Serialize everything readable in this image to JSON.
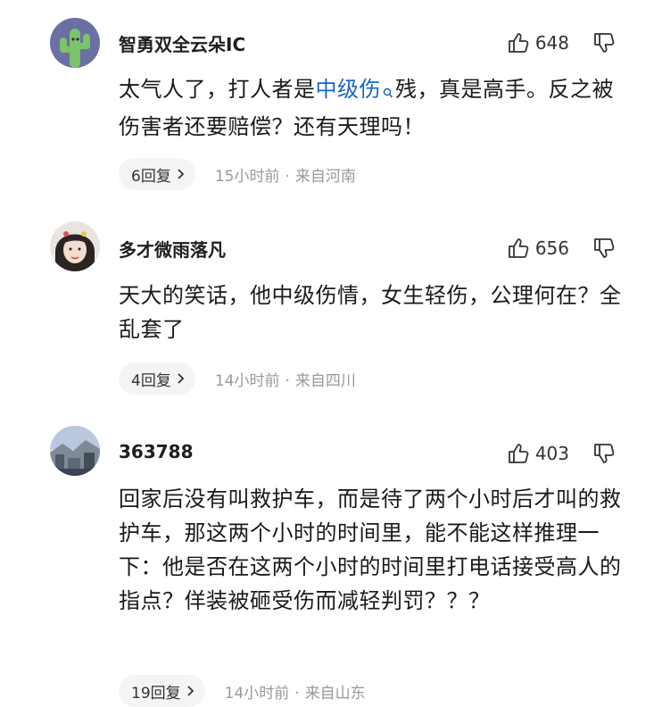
{
  "comments": [
    {
      "username": "智勇双全云朵IC",
      "likes": "648",
      "text_before": "太气人了，打人者是",
      "link_text": "中级伤",
      "text_after": "残，真是高手。反之被伤害者还要赔偿？还有天理吗！",
      "reply_count": "6回复",
      "time": "15小时前",
      "separator": "·",
      "location": "来自河南",
      "avatar_icon": "cactus-avatar",
      "colors": {
        "avatar_bg": "#6b6fa3",
        "cactus": "#7cc46a"
      }
    },
    {
      "username": "多才微雨落凡",
      "likes": "656",
      "text": "天大的笑话，他中级伤情，女生轻伤，公理何在？全乱套了",
      "reply_count": "4回复",
      "time": "14小时前",
      "separator": "·",
      "location": "来自四川",
      "avatar_icon": "person-photo-avatar"
    },
    {
      "username": "363788",
      "likes": "403",
      "text": "回家后没有叫救护车，而是待了两个小时后才叫的救护车，那这两个小时的时间里，能不能这样推理一下：他是否在这两个小时的时间里打电话接受高人的指点？佯装被砸受伤而减轻判罚？？？",
      "reply_count": "19回复",
      "time": "14小时前",
      "separator": "·",
      "location": "来自山东",
      "avatar_icon": "landscape-photo-avatar"
    }
  ],
  "colors": {
    "link": "#1a66c4",
    "meta": "#9a9a9a",
    "reply_bg": "#f4f4f4"
  }
}
